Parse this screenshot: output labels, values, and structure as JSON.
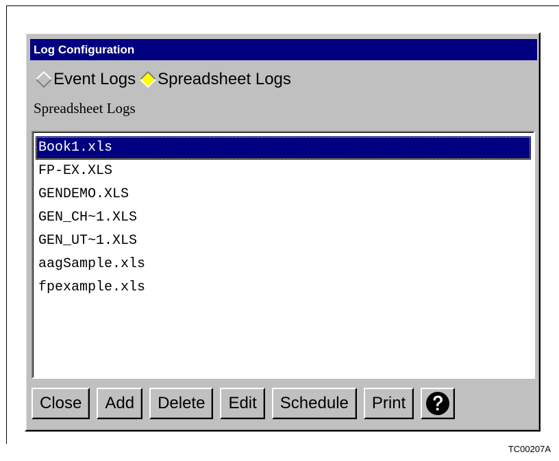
{
  "dialog": {
    "title": "Log Configuration",
    "radio_options": [
      {
        "label": "Event Logs",
        "selected": false
      },
      {
        "label": "Spreadsheet Logs",
        "selected": true
      }
    ],
    "section_label": "Spreadsheet Logs",
    "files": [
      {
        "name": "Book1.xls",
        "selected": true
      },
      {
        "name": "FP-EX.XLS",
        "selected": false
      },
      {
        "name": "GENDEMO.XLS",
        "selected": false
      },
      {
        "name": "GEN_CH~1.XLS",
        "selected": false
      },
      {
        "name": "GEN_UT~1.XLS",
        "selected": false
      },
      {
        "name": "aagSample.xls",
        "selected": false
      },
      {
        "name": "fpexample.xls",
        "selected": false
      }
    ],
    "buttons": {
      "close": "Close",
      "add": "Add",
      "delete": "Delete",
      "edit": "Edit",
      "schedule": "Schedule",
      "print": "Print",
      "help_icon": "question-mark-icon"
    }
  },
  "figure_code": "TC00207A",
  "colors": {
    "titlebar": "#000080",
    "dialog_bg": "#c0c0c0",
    "selection": "#000080",
    "radio_selected": "#ffff00"
  }
}
